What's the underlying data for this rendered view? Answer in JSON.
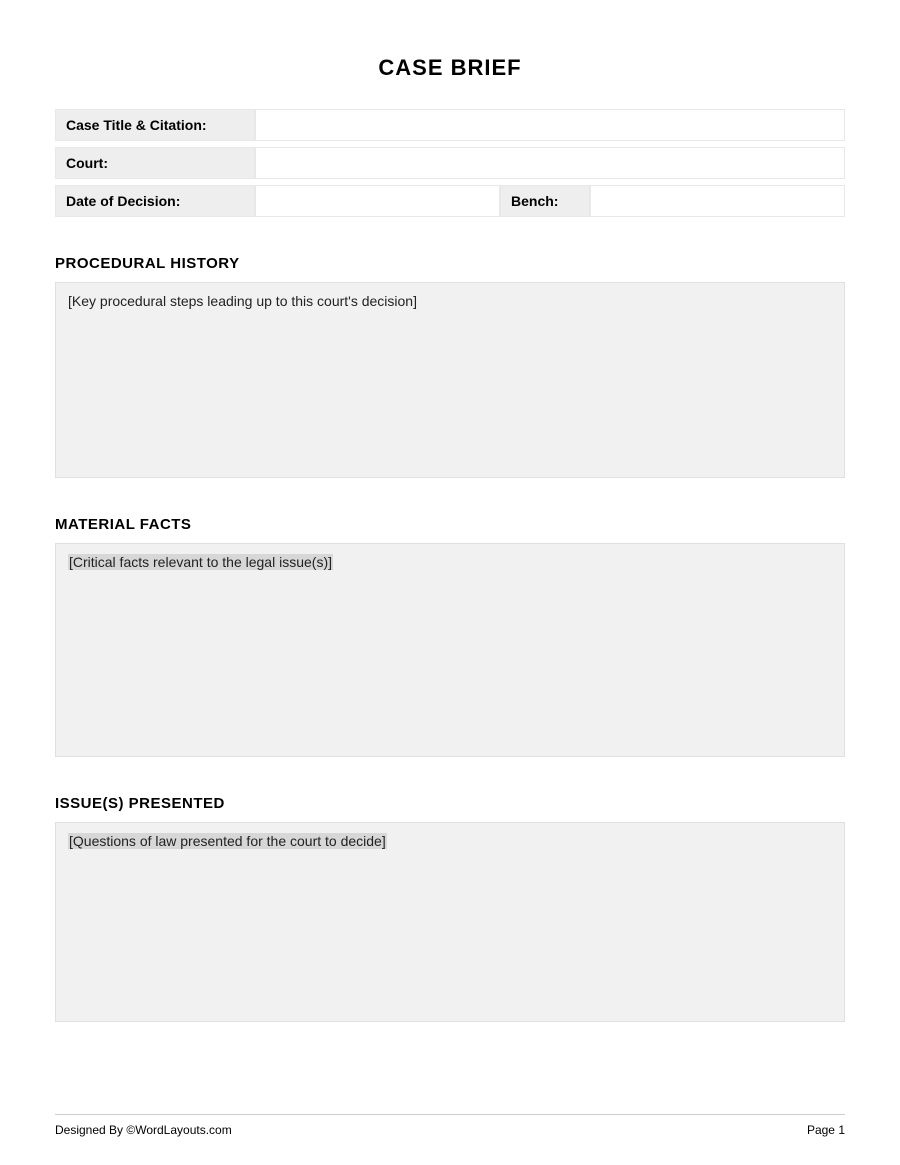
{
  "title": "CASE BRIEF",
  "header": {
    "case_title_label": "Case Title & Citation:",
    "case_title_value": "",
    "court_label": "Court:",
    "court_value": "",
    "date_label": "Date of Decision:",
    "date_value": "",
    "bench_label": "Bench:",
    "bench_value": ""
  },
  "sections": {
    "procedural": {
      "heading": "PROCEDURAL HISTORY",
      "placeholder": "[Key procedural steps leading up to this court's decision]"
    },
    "facts": {
      "heading": "MATERIAL FACTS",
      "placeholder": "[Critical facts relevant to the legal issue(s)]"
    },
    "issues": {
      "heading": "ISSUE(S) PRESENTED",
      "placeholder": "[Questions of law presented for the court to decide]"
    }
  },
  "footer": {
    "left": "Designed By ©WordLayouts.com",
    "right": "Page  1"
  }
}
